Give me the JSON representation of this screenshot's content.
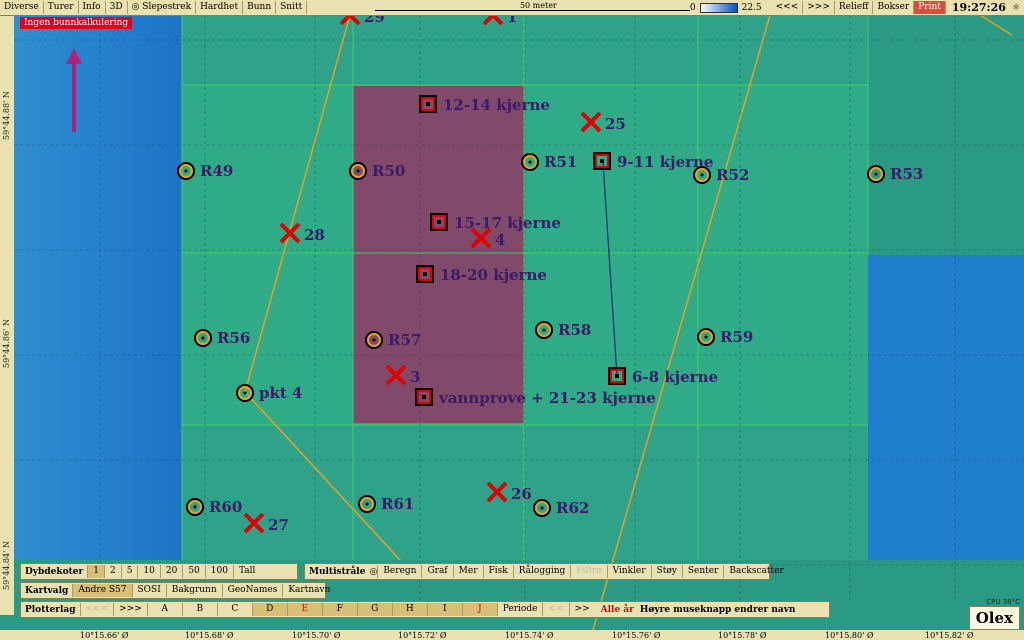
{
  "toolbar": {
    "items": [
      "Diverse",
      "Turer",
      "Info",
      "3D",
      "Slepestrek",
      "Hardhet",
      "Bunn",
      "Snitt"
    ],
    "scale_label": "50 meter",
    "depth_min": "0",
    "depth_max": "22.5",
    "nav_back": "<<<",
    "nav_fwd": ">>>",
    "relief": "Relieff",
    "bokser": "Bokser",
    "print": "Print",
    "clock": "19:27:26"
  },
  "notice": "Ingen bunnkalkulering",
  "lat_labels": [
    "59°44.88' N",
    "59°44.86' N",
    "59°44.84' N"
  ],
  "lon_labels": [
    "10°15.66' Ø",
    "10°15.68' Ø",
    "10°15.70' Ø",
    "10°15.72' Ø",
    "10°15.74' Ø",
    "10°15.76' Ø",
    "10°15.78' Ø",
    "10°15.80' Ø",
    "10°15.82' Ø"
  ],
  "markers": {
    "circles": [
      "R49",
      "R50",
      "R51",
      "R52",
      "R53",
      "R56",
      "R57",
      "R58",
      "R59",
      "pkt 4",
      "R60",
      "R61",
      "R62"
    ],
    "crosses": [
      "25",
      "28",
      "4",
      "3",
      "26",
      "27",
      "29",
      "1"
    ],
    "squares": [
      "12-14 kjerne",
      "9-11 kjerne",
      "15-17 kjerne",
      "18-20 kjerne",
      "6-8 kjerne",
      "vannprove + 21-23 kjerne"
    ]
  },
  "panels": {
    "dybdekoter": {
      "title": "Dybdekoter",
      "items": [
        "1",
        "2",
        "5",
        "10",
        "20",
        "50",
        "100",
        "Tall"
      ],
      "selected": "1"
    },
    "multistraale": {
      "title": "Multistråle",
      "items": [
        "Beregn",
        "Graf",
        "Mer",
        "Fisk",
        "Rålogging",
        "Filtre",
        "Vinkler",
        "Støy",
        "Senter",
        "Backscatter"
      ]
    },
    "kartvalg": {
      "title": "Kartvalg",
      "items": [
        "Andre S57",
        "SOSI",
        "Bakgrunn",
        "GeoNames",
        "Kartnavn"
      ],
      "selected": "Andre S57"
    },
    "plotterlag": {
      "title": "Plotterlag",
      "items": [
        "<<<",
        ">>>",
        "A",
        "B",
        "C",
        "D",
        "E",
        "F",
        "G",
        "H",
        "I",
        "J",
        "Periode",
        "<<",
        ">>"
      ],
      "all_years": "Alle år",
      "hint": "Høyre museknapp endrer navn"
    }
  },
  "cpu": "CPU 38°C",
  "logo": "Olex",
  "colors": {
    "shallow": "#2fa889",
    "deep": "#1b72c4",
    "zone": "#8a3f6a",
    "track": "#e8a020",
    "grid": "#3fc46a"
  }
}
